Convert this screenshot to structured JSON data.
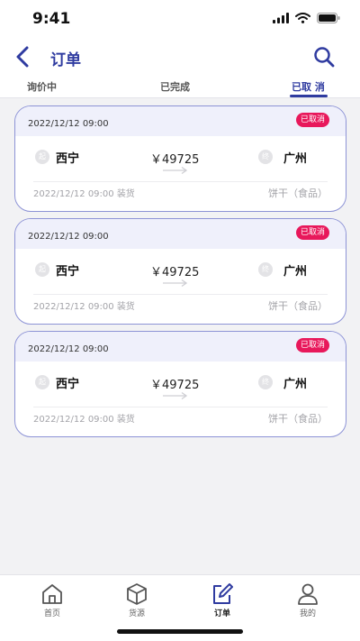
{
  "status_bar": {
    "time": "9:41"
  },
  "nav": {
    "title": "订单",
    "back_icon": "chevron-left-icon",
    "search_icon": "search-icon"
  },
  "tabs": [
    {
      "label": "询价中",
      "active": false
    },
    {
      "label": "已完成",
      "active": false
    },
    {
      "label": "已取 消",
      "active": true
    }
  ],
  "orders": [
    {
      "date": "2022/12/12   09:00",
      "status": "已取消",
      "from_marker": "起",
      "from": "西宁",
      "price": "￥49725",
      "to_marker": "终",
      "to": "广州",
      "load_time": "2022/12/12   09:00  装货",
      "goods": "饼干（食品）"
    },
    {
      "date": "2022/12/12   09:00",
      "status": "已取消",
      "from_marker": "起",
      "from": "西宁",
      "price": "￥49725",
      "to_marker": "终",
      "to": "广州",
      "load_time": "2022/12/12   09:00  装货",
      "goods": "饼干（食品）"
    },
    {
      "date": "2022/12/12   09:00",
      "status": "已取消",
      "from_marker": "起",
      "from": "西宁",
      "price": "￥49725",
      "to_marker": "终",
      "to": "广州",
      "load_time": "2022/12/12   09:00  装货",
      "goods": "饼干（食品）"
    }
  ],
  "tabbar": [
    {
      "label": "首页",
      "icon": "home-icon",
      "active": false
    },
    {
      "label": "货源",
      "icon": "box-icon",
      "active": false
    },
    {
      "label": "订单",
      "icon": "edit-icon",
      "active": true
    },
    {
      "label": "我的",
      "icon": "user-icon",
      "active": false
    }
  ],
  "colors": {
    "accent": "#2f3ba0",
    "badge": "#e8185b",
    "card_border": "#8d93d6",
    "card_header": "#eff0fb"
  }
}
